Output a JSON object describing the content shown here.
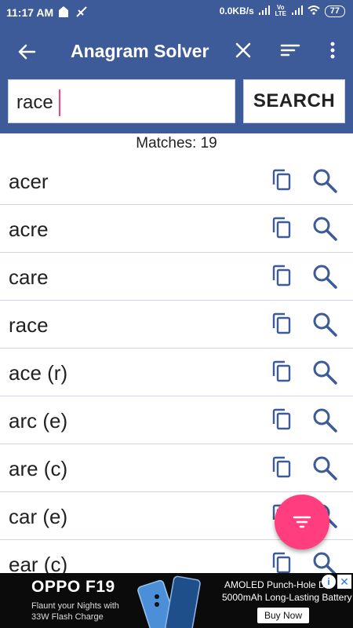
{
  "status_bar": {
    "time": "11:17 AM",
    "network_speed": "0.0KB/s",
    "volte_label": "Vo LTE",
    "battery": "77"
  },
  "app_bar": {
    "title": "Anagram Solver",
    "icons": [
      "arrow-back-icon",
      "close-icon",
      "sort-icon",
      "more-vert-icon"
    ]
  },
  "search": {
    "value": "race",
    "button_label": "SEARCH"
  },
  "results": {
    "matches_label": "Matches: 19",
    "items": [
      {
        "word": "acer"
      },
      {
        "word": "acre"
      },
      {
        "word": "care"
      },
      {
        "word": "race"
      },
      {
        "word": "ace (r)"
      },
      {
        "word": "arc (e)"
      },
      {
        "word": "are (c)"
      },
      {
        "word": "car (e)"
      },
      {
        "word": "ear (c)"
      }
    ]
  },
  "colors": {
    "primary": "#3d5a99",
    "accent": "#ff3d7f",
    "icon": "#3d5a99"
  },
  "ad": {
    "brand": "OPPO F19",
    "sub_line1": "Flaunt your Nights with",
    "sub_line2": "33W Flash Charge",
    "headline1": "AMOLED Punch-Hole Dis",
    "headline2": "5000mAh Long-Lasting Battery",
    "cta": "Buy Now"
  }
}
